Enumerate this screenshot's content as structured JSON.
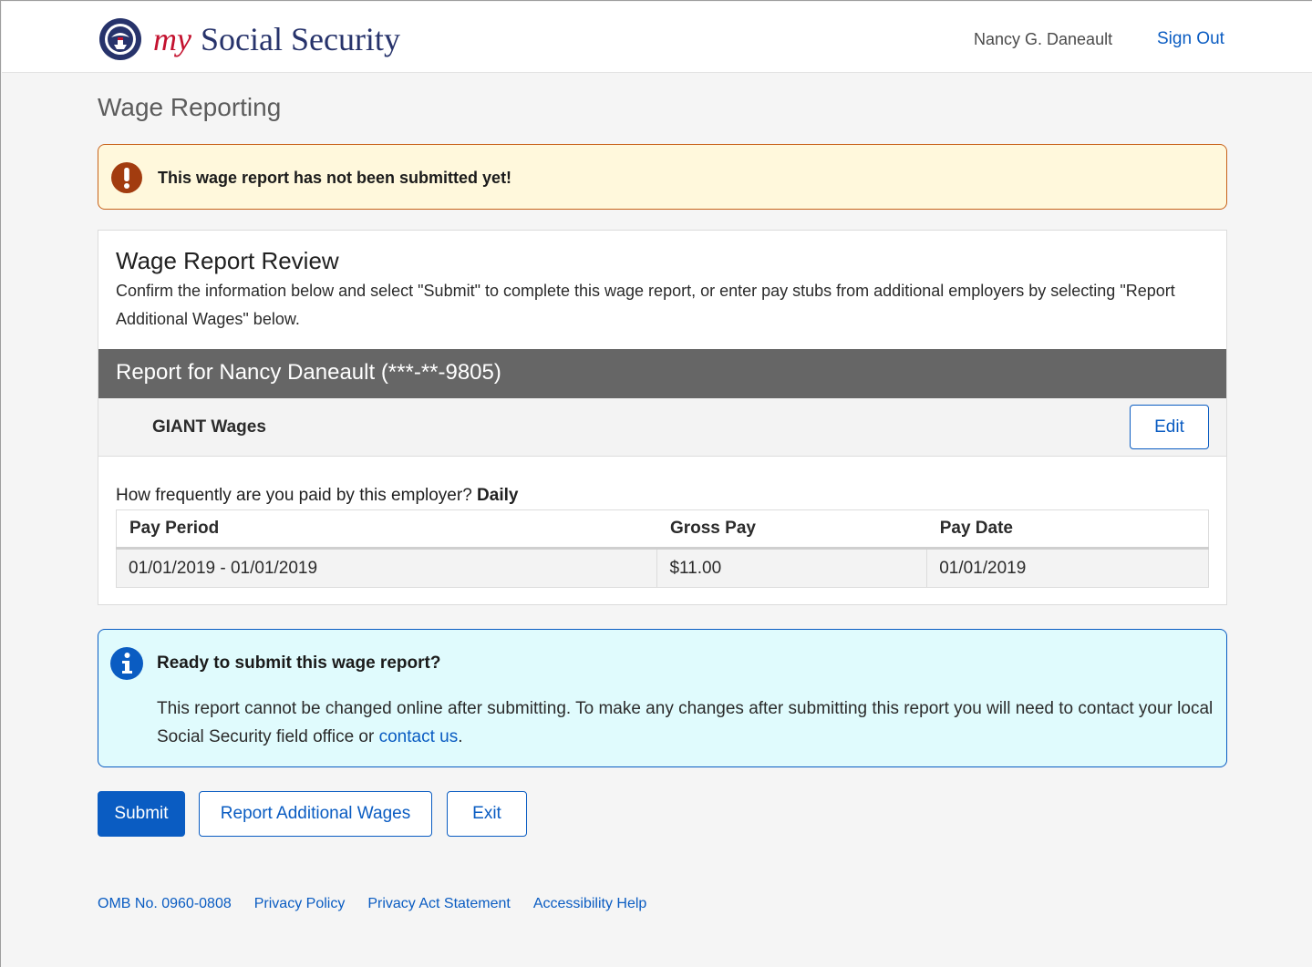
{
  "header": {
    "brand_my": "my",
    "brand_name": "Social Security",
    "user_name": "Nancy G. Daneault",
    "sign_out": "Sign Out"
  },
  "page": {
    "title": "Wage Reporting"
  },
  "warning_alert": {
    "icon": "exclamation-icon",
    "message": "This wage report has not been submitted yet!"
  },
  "review": {
    "title": "Wage Report Review",
    "description": "Confirm the information below and select \"Submit\" to complete this wage report, or enter pay stubs from additional employers by selecting \"Report Additional Wages\" below.",
    "report_header": "Report for Nancy Daneault (***-**-9805)",
    "employer": {
      "name": "GIANT Wages",
      "edit_label": "Edit"
    },
    "frequency_question": "How frequently are you paid by this employer?",
    "frequency_answer": "Daily",
    "table": {
      "columns": [
        "Pay Period",
        "Gross Pay",
        "Pay Date"
      ],
      "rows": [
        [
          "01/01/2019 - 01/01/2019",
          "$11.00",
          "01/01/2019"
        ]
      ]
    }
  },
  "info_alert": {
    "icon": "info-icon",
    "heading": "Ready to submit this wage report?",
    "body_text": "This report cannot be changed online after submitting. To make any changes after submitting this report you will need to contact your local Social Security field office or ",
    "link_text": "contact us",
    "body_end": "."
  },
  "actions": {
    "submit": "Submit",
    "report_additional": "Report Additional Wages",
    "exit": "Exit"
  },
  "footer": {
    "omb": "OMB No. 0960-0808",
    "privacy_policy": "Privacy Policy",
    "privacy_act": "Privacy Act Statement",
    "accessibility": "Accessibility Help"
  },
  "colors": {
    "accent": "#0a5cc2",
    "brand_red": "#c4122f",
    "brand_navy": "#27336b",
    "warning_border": "#c8621a",
    "warning_bg": "#fff8dc",
    "warning_icon": "#a23c0f",
    "info_bg": "#e0fbfd",
    "report_bar": "#666666"
  }
}
